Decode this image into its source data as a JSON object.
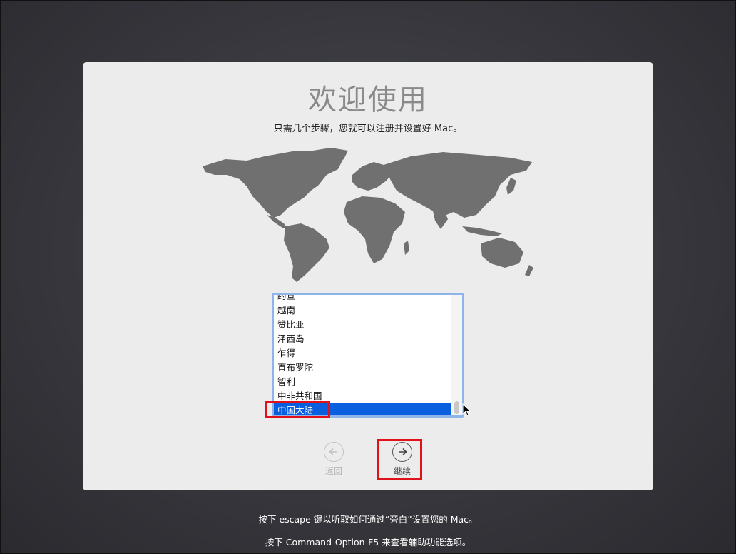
{
  "welcome": {
    "title": "欢迎使用",
    "subtitle": "只需几个步骤，您就可以注册并设置好 Mac。"
  },
  "country_list": {
    "items": [
      {
        "label": "约旦",
        "selected": false
      },
      {
        "label": "越南",
        "selected": false
      },
      {
        "label": "赞比亚",
        "selected": false
      },
      {
        "label": "泽西岛",
        "selected": false
      },
      {
        "label": "乍得",
        "selected": false
      },
      {
        "label": "直布罗陀",
        "selected": false
      },
      {
        "label": "智利",
        "selected": false
      },
      {
        "label": "中非共和国",
        "selected": false
      },
      {
        "label": "中国大陆",
        "selected": true
      }
    ],
    "selected_value": "中国大陆"
  },
  "navigation": {
    "back_label": "返回",
    "back_icon": "arrow-left-icon",
    "continue_label": "继续",
    "continue_icon": "arrow-right-icon"
  },
  "footer": {
    "hint_escape": "按下 escape 键以听取如何通过“旁白”设置您的 Mac。",
    "hint_accessibility": "按下 Command-Option-F5 来查看辅助功能选项。"
  },
  "colors": {
    "selection": "#0a5fe0",
    "highlight_box": "#e0111b",
    "map": "#707070"
  }
}
